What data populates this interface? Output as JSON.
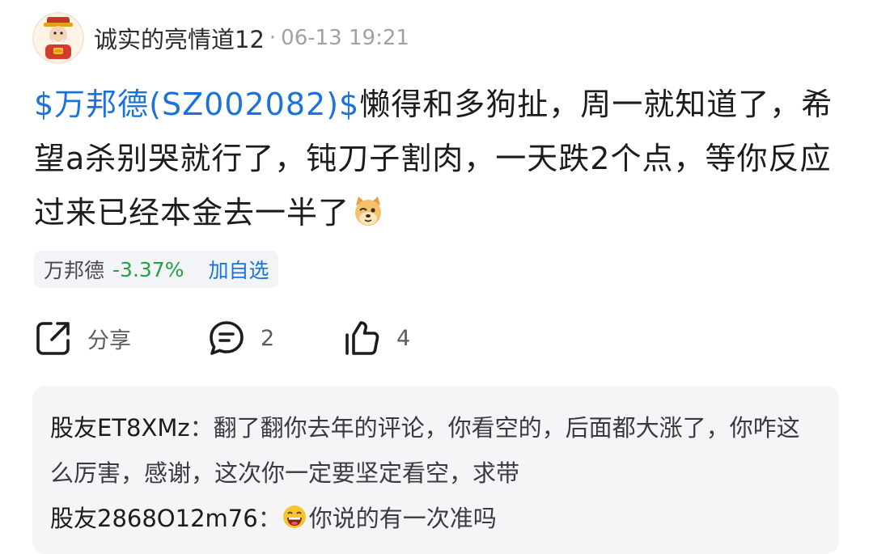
{
  "post": {
    "username": "诚实的亮情道12",
    "meta_separator": "·",
    "timestamp": "06-13 19:21",
    "stock_link": "$万邦德(SZ002082)$",
    "body_text": "懒得和多狗扯，周一就知道了，希望a杀别哭就行了，钝刀子割肉，一天跌2个点，等你反应过来已经本金去一半了",
    "emoji": "doge-emoji"
  },
  "stock_tag": {
    "name": "万邦德",
    "change": "-3.37%",
    "add_label": "加自选",
    "change_color": "#23a043"
  },
  "actions": {
    "share_label": "分享",
    "comment_count": "2",
    "like_count": "4",
    "share_icon": "share-icon",
    "comment_icon": "comment-icon",
    "like_icon": "thumbs-up-icon"
  },
  "comments": [
    {
      "author": "股友ET8XMz",
      "separator": "：",
      "text": "翻了翻你去年的评论，你看空的，后面都大涨了，你咋这么厉害，感谢，这次你一定要坚定看空，求带"
    },
    {
      "author": "股友2868O12m76",
      "separator": "：",
      "emoji": "laughing-emoji",
      "text": "你说的有一次准吗"
    }
  ],
  "colors": {
    "link_blue": "#1a73d9",
    "text_dark": "#1c1c1e",
    "meta_gray": "#a0a0a6",
    "comment_bg": "#f5f5f7"
  }
}
